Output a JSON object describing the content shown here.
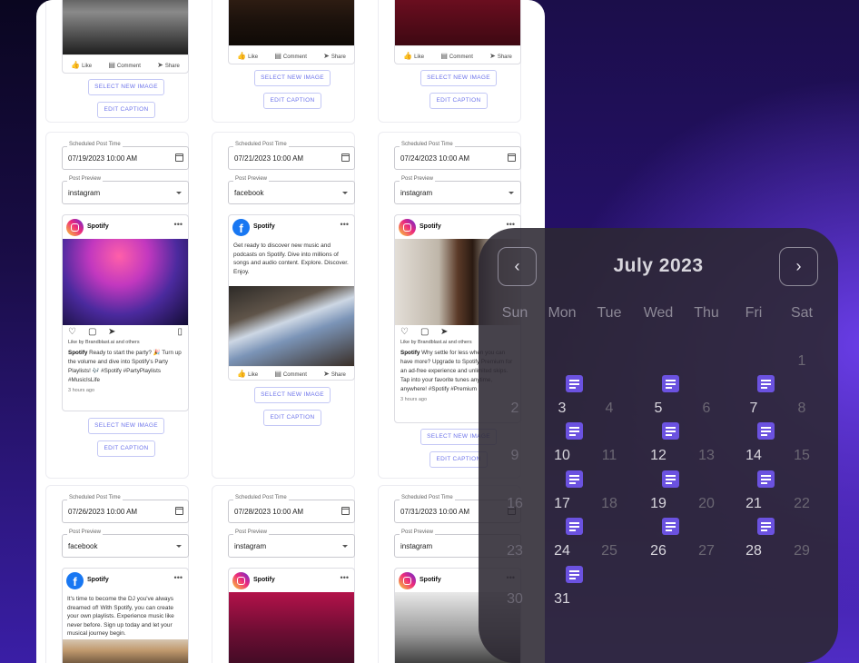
{
  "actions": {
    "like": "Like",
    "comment": "Comment",
    "share": "Share"
  },
  "buttons": {
    "select_image": "SELECT NEW IMAGE",
    "edit_caption": "EDIT CAPTION"
  },
  "fields": {
    "time_label": "Scheduled Post Time",
    "preview_label": "Post Preview"
  },
  "posts": [
    {
      "date": "07/19/2023 10:00 AM",
      "platform": "instagram",
      "account": "Spotify",
      "likes": "Like by Brandblast.ai and others",
      "caption_author": "Spotify",
      "caption": "Ready to start the party? 🎉 Turn up the volume and dive into Spotify's Party Playlists! 🎶 #Spotify #PartyPlaylists #MusicIsLife",
      "ago": "3 hours ago"
    },
    {
      "date": "07/21/2023 10:00 AM",
      "platform": "facebook",
      "account": "Spotify",
      "text": "Get ready to discover new music and podcasts on Spotify. Dive into millions of songs and audio content. Explore. Discover. Enjoy."
    },
    {
      "date": "07/24/2023 10:00 AM",
      "platform": "instagram",
      "account": "Spotify",
      "likes": "Like by Brandblast.ai and others",
      "caption_author": "Spotify",
      "caption": "Why settle for less when you can have more? Upgrade to Spotify Premium for an ad-free experience and unlimited skips. Tap into your favorite tunes anytime, anywhere! #Spotify #Premium",
      "ago": "3 hours ago"
    },
    {
      "date": "07/26/2023 10:00 AM",
      "platform": "facebook",
      "account": "Spotify",
      "text": "It's time to become the DJ you've always dreamed of! With Spotify, you can create your own playlists. Experience music like never before. Sign up today and let your musical journey begin."
    },
    {
      "date": "07/28/2023 10:00 AM",
      "platform": "instagram",
      "account": "Spotify"
    },
    {
      "date": "07/31/2023 10:00 AM",
      "platform": "instagram",
      "account": "Spotify"
    }
  ],
  "calendar": {
    "title": "July 2023",
    "prev": "‹",
    "next": "›",
    "weekdays": [
      "Sun",
      "Mon",
      "Tue",
      "Wed",
      "Thu",
      "Fri",
      "Sat"
    ],
    "event_days": [
      3,
      5,
      7,
      10,
      12,
      14,
      17,
      19,
      21,
      24,
      26,
      28,
      31
    ]
  }
}
